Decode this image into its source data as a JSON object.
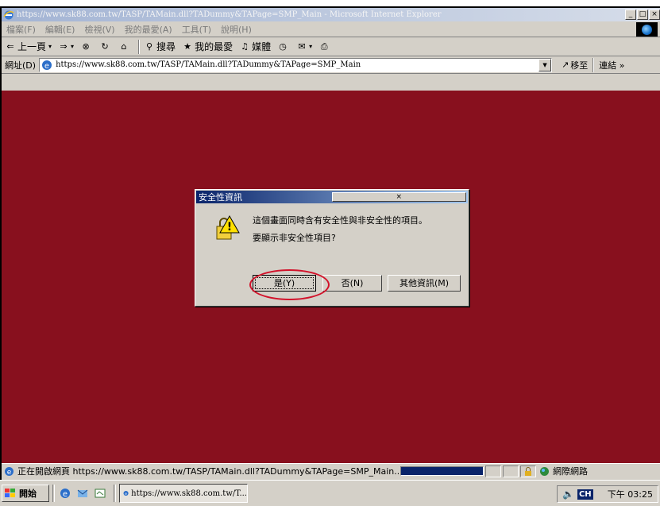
{
  "window": {
    "title": "https://www.sk88.com.tw/TASP/TAMain.dll?TADummy&TAPage=SMP_Main - Microsoft Internet Explorer",
    "min_label": "_",
    "max_label": "□",
    "close_label": "×"
  },
  "menubar": {
    "items": [
      "檔案(F)",
      "編輯(E)",
      "檢視(V)",
      "我的最愛(A)",
      "工具(T)",
      "說明(H)"
    ]
  },
  "toolbar": {
    "back": "上一頁",
    "search": "搜尋",
    "favorites": "我的最愛",
    "media": "媒體"
  },
  "address": {
    "label": "網址(D)",
    "url": "https://www.sk88.com.tw/TASP/TAMain.dll?TADummy&TAPage=SMP_Main",
    "go_label": "移至",
    "links_label": "連結 »"
  },
  "dialog": {
    "title": "安全性資訊",
    "message_line1": "這個畫面同時含有安全性與非安全性的項目。",
    "message_line2": "要顯示非安全性項目?",
    "yes_label": "是(Y)",
    "no_label": "否(N)",
    "more_info_label": "其他資訊(M)",
    "close_label": "×"
  },
  "statusbar": {
    "text": "正在開啟網頁 https://www.sk88.com.tw/TASP/TAMain.dll?TADummy&TAPage=SMP_Main...",
    "zone": "網際網路"
  },
  "taskbar": {
    "start_label": "開始",
    "task_label": "https://www.sk88.com.tw/T...",
    "ime_label": "CH",
    "clock": "下午 03:25"
  },
  "colors": {
    "page_background": "#88101e",
    "dialog_title_start": "#0a246a",
    "highlight_ring": "#d2122a"
  }
}
